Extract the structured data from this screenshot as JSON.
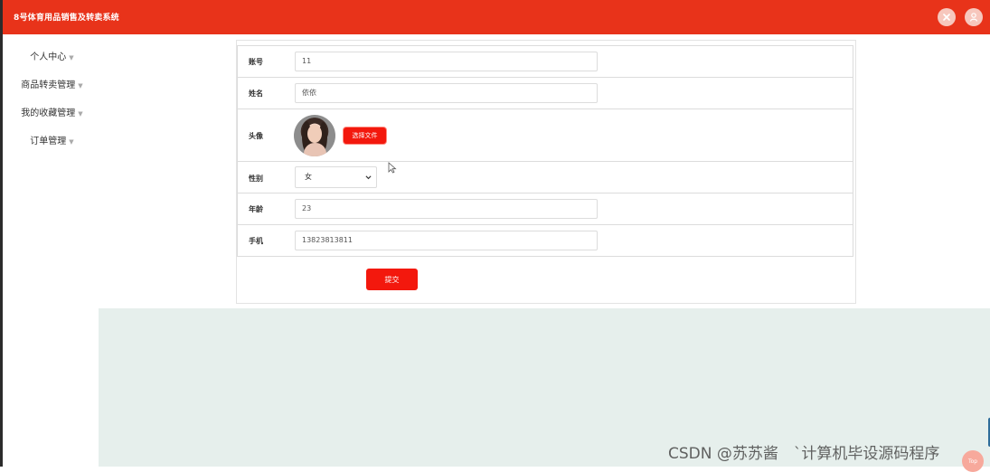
{
  "header": {
    "title": "8号体育用品销售及转卖系统",
    "icons": [
      "close-icon",
      "user-icon"
    ]
  },
  "sidebar": {
    "items": [
      {
        "label": "个人中心",
        "icon": "chevron-down-icon"
      },
      {
        "label": "商品转卖管理",
        "icon": "chevron-down-icon"
      },
      {
        "label": "我的收藏管理",
        "icon": "chevron-down-icon"
      },
      {
        "label": "订单管理",
        "icon": "chevron-down-icon"
      }
    ]
  },
  "form": {
    "account": {
      "label": "账号",
      "value": "11"
    },
    "name": {
      "label": "姓名",
      "value": "依依"
    },
    "avatar": {
      "label": "头像",
      "button": "选择文件"
    },
    "gender": {
      "label": "性别",
      "value": "女",
      "options": [
        "女"
      ]
    },
    "age": {
      "label": "年龄",
      "value": "23"
    },
    "phone": {
      "label": "手机",
      "value": "13823813811"
    },
    "submit": "提交"
  },
  "overlay": {
    "watermark": "CSDN @苏苏酱　`计算机毕设源码程序",
    "corner_badge": "Top"
  },
  "colors": {
    "brand": "#e8331a",
    "button": "#f3180d",
    "content_background": "#e6efec"
  }
}
